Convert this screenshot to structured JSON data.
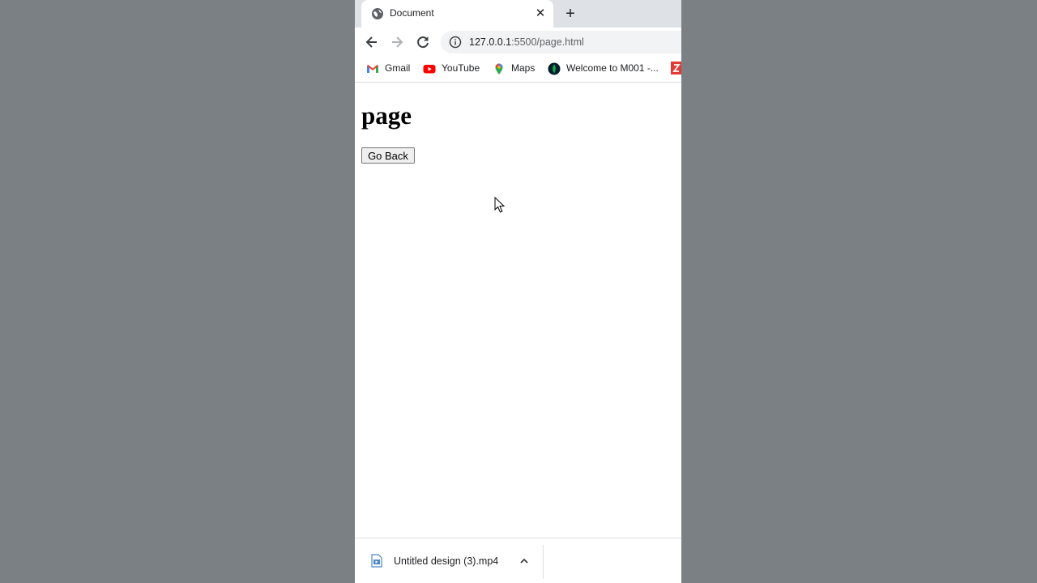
{
  "tab": {
    "title": "Document",
    "favicon": "globe-icon"
  },
  "toolbar": {
    "url_host": "127.0.0.1",
    "url_rest": ":5500/page.html"
  },
  "bookmarks": [
    {
      "label": "Gmail",
      "icon": "gmail-icon"
    },
    {
      "label": "YouTube",
      "icon": "youtube-icon"
    },
    {
      "label": "Maps",
      "icon": "maps-icon"
    },
    {
      "label": "Welcome to M001 -...",
      "icon": "mongodb-icon"
    }
  ],
  "page": {
    "heading": "page",
    "button_label": "Go Back"
  },
  "download": {
    "filename": "Untitled design (3).mp4"
  },
  "colors": {
    "outer_background": "#7a8083",
    "tab_strip": "#dee1e6",
    "youtube_red": "#ff0000",
    "mongodb_green": "#13aa52"
  }
}
